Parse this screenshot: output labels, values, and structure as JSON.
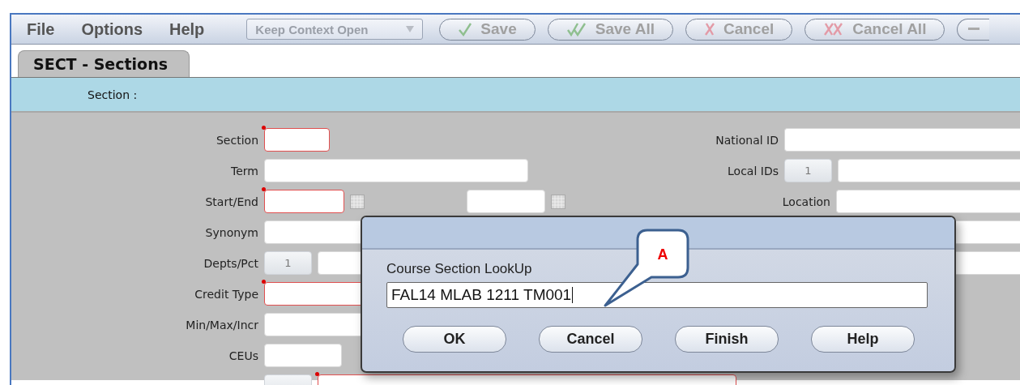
{
  "menu": [
    {
      "label": "File"
    },
    {
      "label": "Options"
    },
    {
      "label": "Help"
    }
  ],
  "toolbar": {
    "context_dropdown": {
      "label": "Keep Context Open",
      "disabled": true
    },
    "buttons": [
      {
        "label": "Save",
        "kind": "save",
        "disabled": true
      },
      {
        "label": "Save All",
        "kind": "save_all",
        "disabled": true
      },
      {
        "label": "Cancel",
        "kind": "cancel",
        "disabled": true
      },
      {
        "label": "Cancel All",
        "kind": "cancel_all",
        "disabled": true
      }
    ]
  },
  "tabs": [
    {
      "label": "SECT - Sections",
      "selected": true
    }
  ],
  "header": {
    "label": "Section :"
  },
  "left_fields": [
    {
      "label": "Section",
      "required": true
    },
    {
      "label": "Term",
      "required": false
    },
    {
      "label": "Start/End",
      "required": true
    },
    {
      "label": "Synonym",
      "required": false
    },
    {
      "label": "Depts/Pct",
      "required": false,
      "count": "1"
    },
    {
      "label": "Credit Type",
      "required": true
    },
    {
      "label": "Min/Max/Incr",
      "required": false
    },
    {
      "label": "CEUs",
      "required": false
    },
    {
      "required": true
    }
  ],
  "right_fields": [
    {
      "kind": "text",
      "label": "National ID"
    },
    {
      "kind": "counted",
      "label": "Local IDs",
      "count": "1"
    },
    {
      "kind": "text",
      "label": "Location"
    },
    {
      "kind": "text"
    },
    {
      "kind": "text"
    }
  ],
  "dialog": {
    "label": "Course Section LookUp",
    "value": "FAL14 MLAB 1211 TM001",
    "buttons": [
      {
        "label": "OK"
      },
      {
        "label": "Cancel"
      },
      {
        "label": "Finish"
      },
      {
        "label": "Help"
      }
    ]
  },
  "callout": {
    "label": "A"
  }
}
